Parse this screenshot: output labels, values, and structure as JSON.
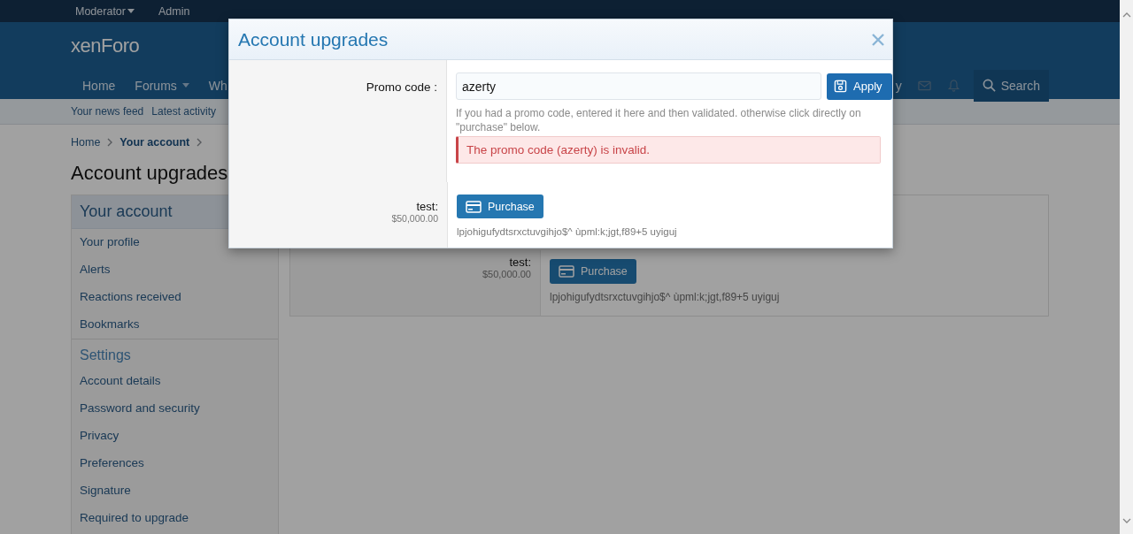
{
  "top_bar": [
    {
      "label": "Moderator",
      "dropdown": true
    },
    {
      "label": "Admin",
      "dropdown": false
    }
  ],
  "header": {
    "logo": "xenForo",
    "nav": [
      {
        "label": "Home",
        "dropdown": false
      },
      {
        "label": "Forums",
        "dropdown": true
      },
      {
        "label": "Wh",
        "dropdown": false
      }
    ],
    "nav_right": "y",
    "search": "Search"
  },
  "sub_nav": [
    "Your news feed",
    "Latest activity"
  ],
  "breadcrumb": [
    {
      "label": "Home",
      "current": false
    },
    {
      "label": "Your account",
      "current": true
    }
  ],
  "page_title": "Account upgrades",
  "sidebar": [
    {
      "title": "Your account",
      "kind": "panel-title",
      "items": [
        "Your profile",
        "Alerts",
        "Reactions received",
        "Bookmarks"
      ]
    },
    {
      "title": "Settings",
      "kind": "section-title",
      "items": [
        "Account details",
        "Password and security",
        "Privacy",
        "Preferences",
        "Signature",
        "Required to upgrade"
      ]
    }
  ],
  "upgrades": [
    {
      "name": "test:",
      "price": "$50,000.00",
      "button": "Purchase",
      "description": "lpjohigufydtsrxctuvgihjo$^ ùpml:k;jgt,f89+5 uyiguj"
    }
  ],
  "modal": {
    "title": "Account upgrades",
    "promo": {
      "label": "Promo code :",
      "value": "azerty",
      "button": "Apply",
      "hint": "If you had a promo code, entered it here and then validated. otherwise click directly on \"purchase\" below.",
      "error": "The promo code (azerty) is invalid."
    },
    "upgrades": [
      {
        "name": "test:",
        "price": "$50,000.00",
        "button": "Purchase",
        "description": "lpjohigufydtsrxctuvgihjo$^ ùpml:k;jgt,f89+5 uyiguj"
      }
    ]
  }
}
